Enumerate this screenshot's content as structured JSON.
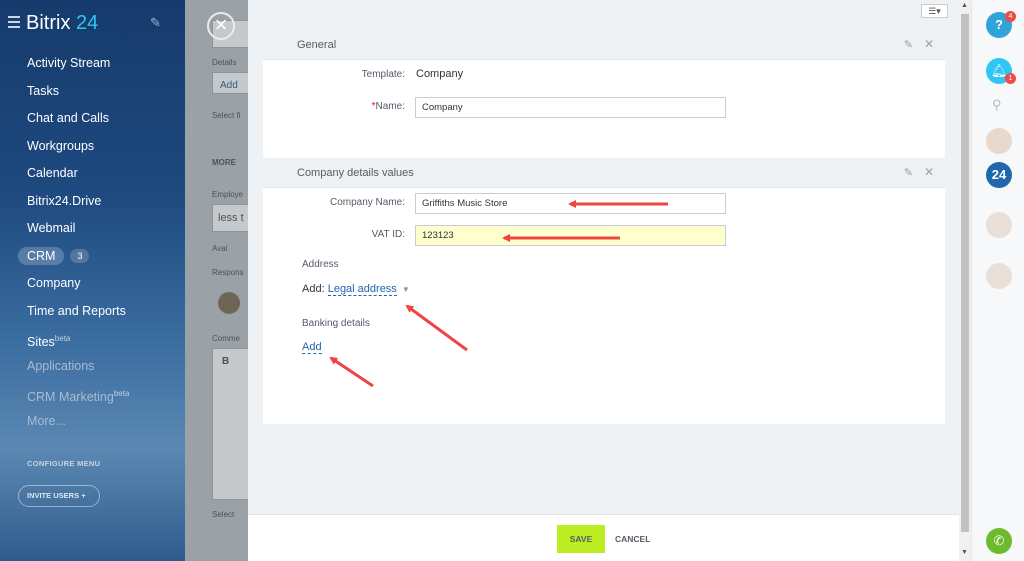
{
  "sidebar": {
    "logo": "Bitrix",
    "logo_num": "24",
    "items": [
      {
        "label": "Activity Stream"
      },
      {
        "label": "Tasks"
      },
      {
        "label": "Chat and Calls"
      },
      {
        "label": "Workgroups"
      },
      {
        "label": "Calendar"
      },
      {
        "label": "Bitrix24.Drive"
      },
      {
        "label": "Webmail"
      },
      {
        "label": "CRM",
        "count": "3"
      },
      {
        "label": "Company"
      },
      {
        "label": "Time and Reports"
      },
      {
        "label": "Sites",
        "sup": "beta"
      },
      {
        "label": "Applications"
      },
      {
        "label": "CRM Marketing",
        "sup": "beta"
      },
      {
        "label": "More..."
      }
    ],
    "configure_menu": "CONFIGURE MENU",
    "invite_users": "INVITE USERS"
  },
  "background_page": {
    "details_label": "Details",
    "add_link": "Add",
    "select_text": "Select fi",
    "more_label": "MORE",
    "employee_label": "Employe",
    "less_text": "less t",
    "avail_text": "Avai",
    "respons_label": "Respons",
    "comments_label": "Comme",
    "bold_btn": "B",
    "select2": "Select"
  },
  "slider": {
    "general": {
      "title": "General",
      "template_label": "Template:",
      "template_value": "Company",
      "name_label": "Name:",
      "name_required": "*",
      "name_value": "Company"
    },
    "company_details": {
      "title": "Company details values",
      "company_name_label": "Company Name:",
      "company_name_value": "Griffiths Music Store",
      "vat_label": "VAT ID:",
      "vat_value": "123123",
      "address_title": "Address",
      "address_add": "Add:",
      "address_link": "Legal address",
      "banking_title": "Banking details",
      "banking_add": "Add"
    }
  },
  "footer": {
    "save": "SAVE",
    "cancel": "CANCEL"
  },
  "rightbar": {
    "help_badge": "4",
    "bell_badge": "1",
    "bitrix_label": "24"
  },
  "colors": {
    "accent": "#2fc6f6",
    "save_button": "#bbed21",
    "annotation_arrow": "#ef4444",
    "vat_highlight": "#ffffcd",
    "call_button": "#6dbb2c"
  }
}
